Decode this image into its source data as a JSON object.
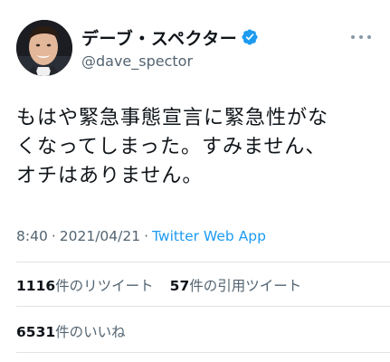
{
  "tweet": {
    "author": {
      "display_name": "デーブ・スペクター",
      "handle": "@dave_spector",
      "verified": true
    },
    "text_lines": [
      "もはや緊急事態宣言に緊急性がな",
      "くなってしまった。すみません、",
      "オチはありません。"
    ],
    "time": "8:40",
    "date": "2021/04/21",
    "separator": "·",
    "source": "Twitter Web App",
    "retweets": {
      "count": "1116",
      "label": "件のリツイート"
    },
    "quotes": {
      "count": "57",
      "label": "件の引用ツイート"
    },
    "likes": {
      "count": "6531",
      "label": "件のいいね"
    }
  },
  "colors": {
    "text": "#0f1419",
    "secondary": "#536471",
    "link": "#1d9bf0",
    "verified": "#1d9bf0",
    "divider": "#dfe3e6"
  },
  "icons": [
    "verified-badge-icon",
    "more-options-icon"
  ]
}
